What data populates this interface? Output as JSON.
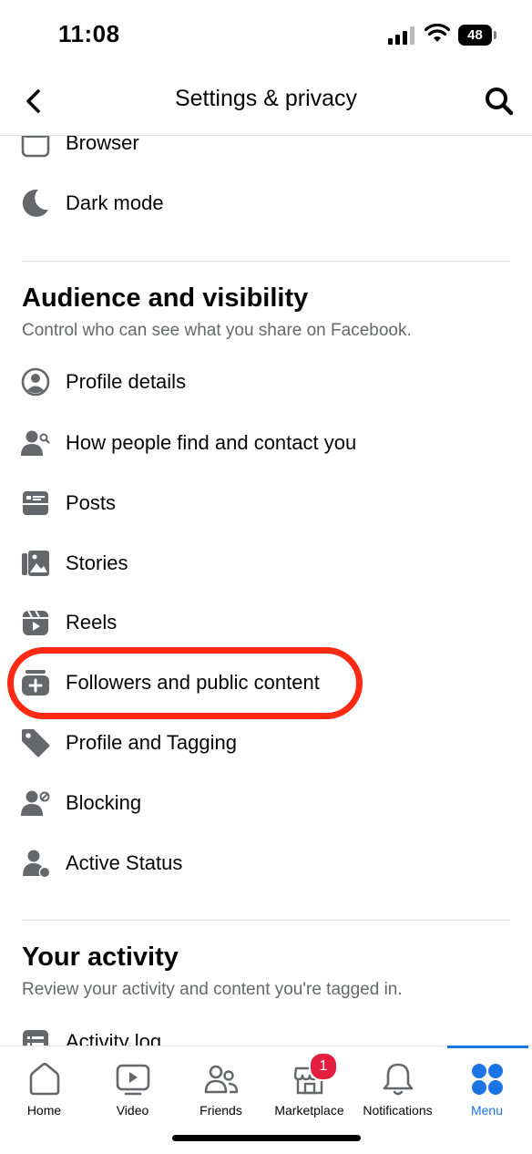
{
  "status": {
    "time": "11:08",
    "battery": "48"
  },
  "header": {
    "title": "Settings & privacy"
  },
  "top_items": [
    {
      "label": "Browser",
      "icon": "browser-icon"
    },
    {
      "label": "Dark mode",
      "icon": "moon-icon"
    }
  ],
  "audience": {
    "title": "Audience and visibility",
    "subtitle": "Control who can see what you share on Facebook.",
    "items": [
      {
        "label": "Profile details",
        "icon": "user-circle-icon"
      },
      {
        "label": "How people find and contact you",
        "icon": "user-search-icon"
      },
      {
        "label": "Posts",
        "icon": "posts-icon"
      },
      {
        "label": "Stories",
        "icon": "stories-icon"
      },
      {
        "label": "Reels",
        "icon": "reels-icon"
      },
      {
        "label": "Followers and public content",
        "icon": "followers-icon",
        "highlighted": true
      },
      {
        "label": "Profile and Tagging",
        "icon": "tag-icon"
      },
      {
        "label": "Blocking",
        "icon": "block-user-icon"
      },
      {
        "label": "Active Status",
        "icon": "active-status-icon"
      }
    ]
  },
  "activity": {
    "title": "Your activity",
    "subtitle": "Review your activity and content you're tagged in.",
    "items": [
      {
        "label": "Activity log",
        "icon": "activity-log-icon"
      }
    ]
  },
  "bottom_nav": {
    "items": [
      {
        "label": "Home",
        "icon": "home-icon"
      },
      {
        "label": "Video",
        "icon": "video-icon"
      },
      {
        "label": "Friends",
        "icon": "friends-icon"
      },
      {
        "label": "Marketplace",
        "icon": "marketplace-icon",
        "badge": "1"
      },
      {
        "label": "Notifications",
        "icon": "bell-icon"
      },
      {
        "label": "Menu",
        "icon": "menu-icon",
        "active": true
      }
    ]
  },
  "colors": {
    "accent": "#1b74e4",
    "highlight": "#ff2a14",
    "badge": "#e41e3f",
    "icon": "#65676b"
  }
}
